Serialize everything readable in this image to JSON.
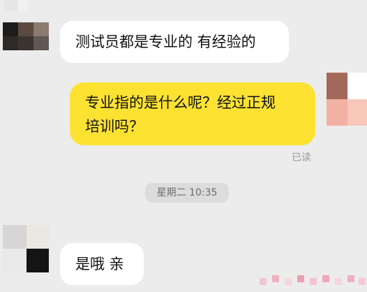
{
  "messages": [
    {
      "sender": "contact",
      "text": "测试员都是专业的 有经验的"
    },
    {
      "sender": "self",
      "text_line1": "专业指的是什么呢？经过正规",
      "text_line2": "培训吗？",
      "status": "已读"
    },
    {
      "sender": "contact",
      "text": "是哦 亲"
    }
  ],
  "timestamp": "星期二 10:35"
}
